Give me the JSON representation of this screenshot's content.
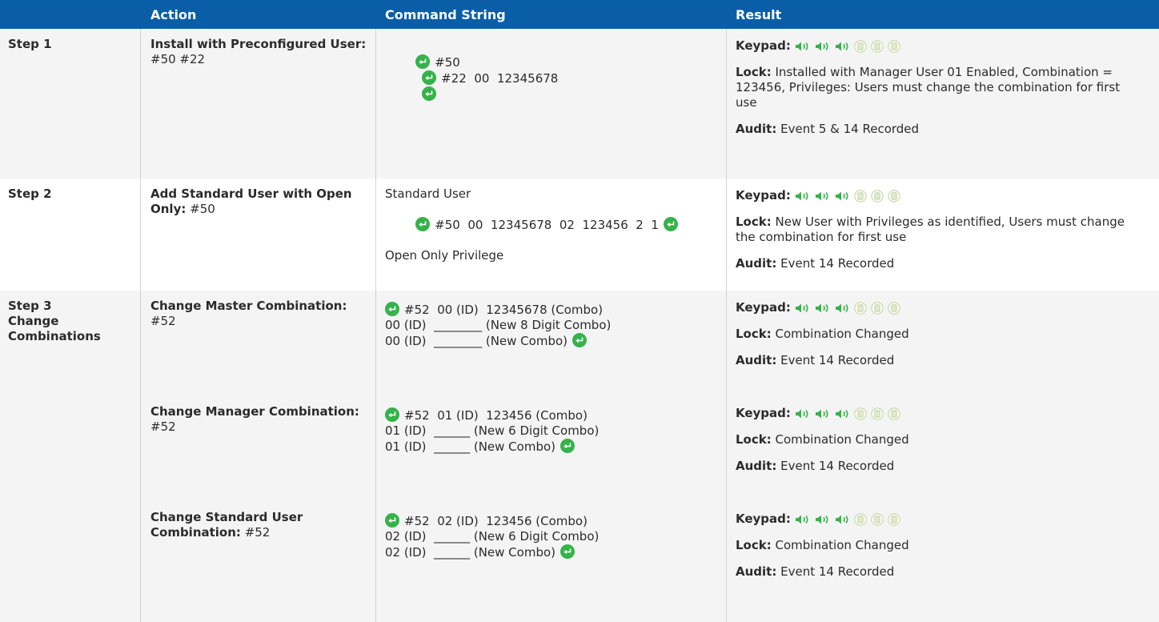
{
  "header": {
    "col_action": "Action",
    "col_command": "Command String",
    "col_result": "Result"
  },
  "colors": {
    "header_bg": "#0a5ea8",
    "accent_green": "#35b34a",
    "alt_row": "#f4f4f4"
  },
  "labels": {
    "keypad": "Keypad:",
    "lock": "Lock:",
    "audit": "Audit:"
  },
  "rows": [
    {
      "step": "Step 1",
      "action_bold": "Install with Preconfigured User:",
      "action_rest": " #50 #22",
      "cmd_segments": [
        "#50",
        "#22  00  12345678"
      ],
      "lock": " Installed with Manager User 01 Enabled, Combination = 123456, Privileges: Users must change the combination for first use",
      "audit": " Event 5 & 14 Recorded"
    },
    {
      "step": "Step 2",
      "action_bold": "Add Standard User with Open Only:",
      "action_rest": " #50",
      "cmd_title": "Standard User",
      "cmd_line": "#50  00  12345678  02  123456  2  1",
      "cmd_note": "Open Only Privilege",
      "lock": " New User with Privileges as identified, Users must change the combination for first use",
      "audit": " Event 14 Recorded"
    }
  ],
  "step3": {
    "step_line1": "Step 3",
    "step_line2": "Change Combinations",
    "subs": [
      {
        "action_bold": "Change Master Combination:",
        "action_rest": " #52",
        "cmd_line1": "#52  00 (ID)  12345678 (Combo)",
        "cmd_line2": "00 (ID)  ________ (New 8 Digit Combo)",
        "cmd_line3": "00 (ID)  ________ (New Combo)",
        "lock": " Combination Changed",
        "audit": " Event 14 Recorded"
      },
      {
        "action_bold": "Change Manager Combination:",
        "action_rest": " #52",
        "cmd_line1": "#52  01 (ID)  123456 (Combo)",
        "cmd_line2": "01 (ID)  ______ (New 6 Digit Combo)",
        "cmd_line3": "01 (ID)  ______ (New Combo)",
        "lock": " Combination Changed",
        "audit": " Event 14 Recorded"
      },
      {
        "action_bold": "Change Standard User Combination:",
        "action_rest": " #52",
        "cmd_line1": "#52  02 (ID)  123456 (Combo)",
        "cmd_line2": "02 (ID)  ______ (New 6 Digit Combo)",
        "cmd_line3": "02 (ID)  ______ (New Combo)",
        "lock": " Combination Changed",
        "audit": " Event 14 Recorded"
      }
    ]
  },
  "icons": {
    "enter": "enter-key-icon",
    "beep": "speaker-beep-icon",
    "keypad": "keypad-light-icon"
  }
}
